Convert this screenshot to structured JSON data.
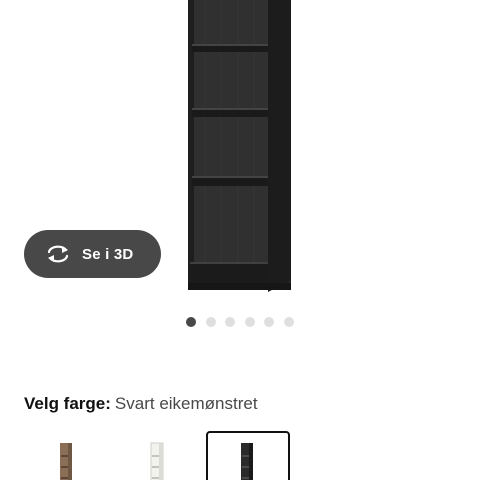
{
  "product": {
    "view_3d_label": "Se i 3D",
    "gallery": {
      "dot_count": 6,
      "active_index": 0
    }
  },
  "color_picker": {
    "label": "Velg farge:",
    "selected_value": "Svart eikemønstret",
    "options": [
      {
        "color": "#8a6f56",
        "selected": false
      },
      {
        "color": "#f2f2ee",
        "selected": false
      },
      {
        "color": "#2a2a2a",
        "selected": true
      }
    ]
  },
  "colors": {
    "button_bg": "#484848",
    "dot_active": "#484848",
    "dot_inactive": "#dfdfdf",
    "shelf_black": "#2b2b2b"
  }
}
